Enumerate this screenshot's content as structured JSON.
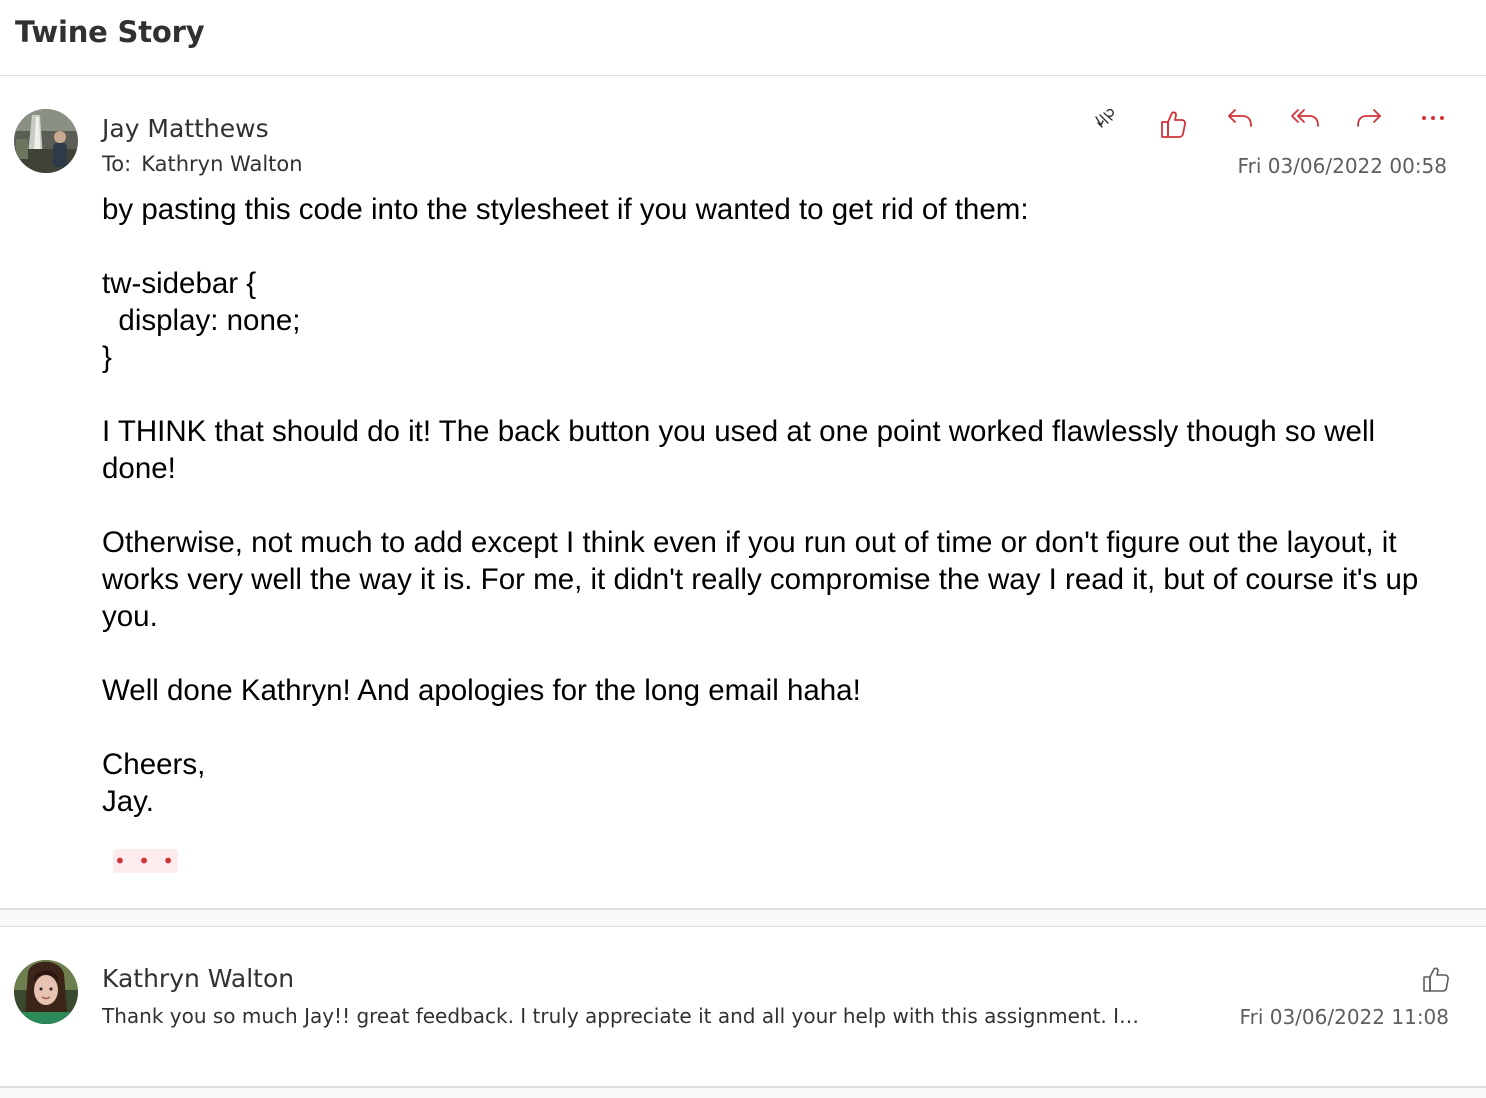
{
  "subject": "Twine Story",
  "messages": [
    {
      "sender": "Jay Matthews",
      "to_label": "To:",
      "to": "Kathryn Walton",
      "timestamp": "Fri 03/06/2022 00:58",
      "actions": {
        "immersive_reader": "immersive-reader-icon",
        "like": "like-icon",
        "reply": "reply-icon",
        "reply_all": "reply-all-icon",
        "forward": "forward-icon",
        "more": "more-actions-icon"
      },
      "body": {
        "line1": "by pasting this code into the stylesheet if you wanted to get rid of them:",
        "code1": "tw-sidebar {",
        "code2": "  display: none;",
        "code3": "}",
        "para2": "I THINK that should do it! The back button you used at one point worked flawlessly though so well done!",
        "para3": "Otherwise, not much to add except I think even if you run out of time or don't figure out the layout, it works very well the way it is. For me, it didn't really compromise the way I read it, but of course it's up you.",
        "para4": "Well done Kathryn! And apologies for the long email haha!",
        "sign1": "Cheers,",
        "sign2": "Jay."
      },
      "show_more": "• • •"
    },
    {
      "sender": "Kathryn Walton",
      "preview": "Thank you so much Jay!! great feedback. I truly appreciate it and all your help with this assignment. I'll d...",
      "timestamp": "Fri 03/06/2022 11:08"
    }
  ],
  "colors": {
    "accent": "#d13438",
    "divider": "#e1dfdd",
    "muted_text": "#605e5c"
  }
}
